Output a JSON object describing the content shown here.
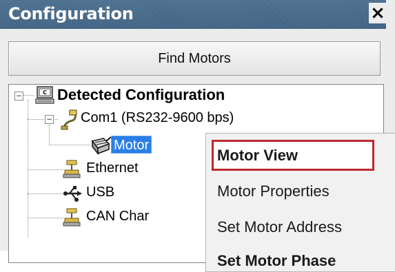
{
  "window": {
    "title": "Configuration",
    "close_glyph": "×"
  },
  "toolbar": {
    "find_motors_label": "Find Motors"
  },
  "tree": {
    "root": {
      "label": "Detected Configuration",
      "expander": "−",
      "icon": "computer-icon"
    },
    "com1": {
      "label": "Com1 (RS232-9600 bps)",
      "expander": "−",
      "icon": "serial-cable-icon"
    },
    "motor": {
      "label": "Motor",
      "icon": "motor-icon",
      "selected": true
    },
    "ethernet": {
      "label": "Ethernet",
      "icon": "network-port-icon"
    },
    "usb": {
      "label": "USB",
      "icon": "usb-icon"
    },
    "can": {
      "label": "CAN Char",
      "icon": "network-port-icon"
    }
  },
  "context_menu": {
    "items": [
      {
        "label": "Motor View",
        "bold": true,
        "highlighted": true
      },
      {
        "label": "Motor Properties",
        "bold": false
      },
      {
        "label": "Set Motor Address",
        "bold": false
      },
      {
        "label": "Set Motor Phase",
        "bold": true
      }
    ]
  },
  "colors": {
    "titlebar": "#4a6e8e",
    "selection": "#2a7fe6",
    "highlight_border": "#c0282e"
  }
}
